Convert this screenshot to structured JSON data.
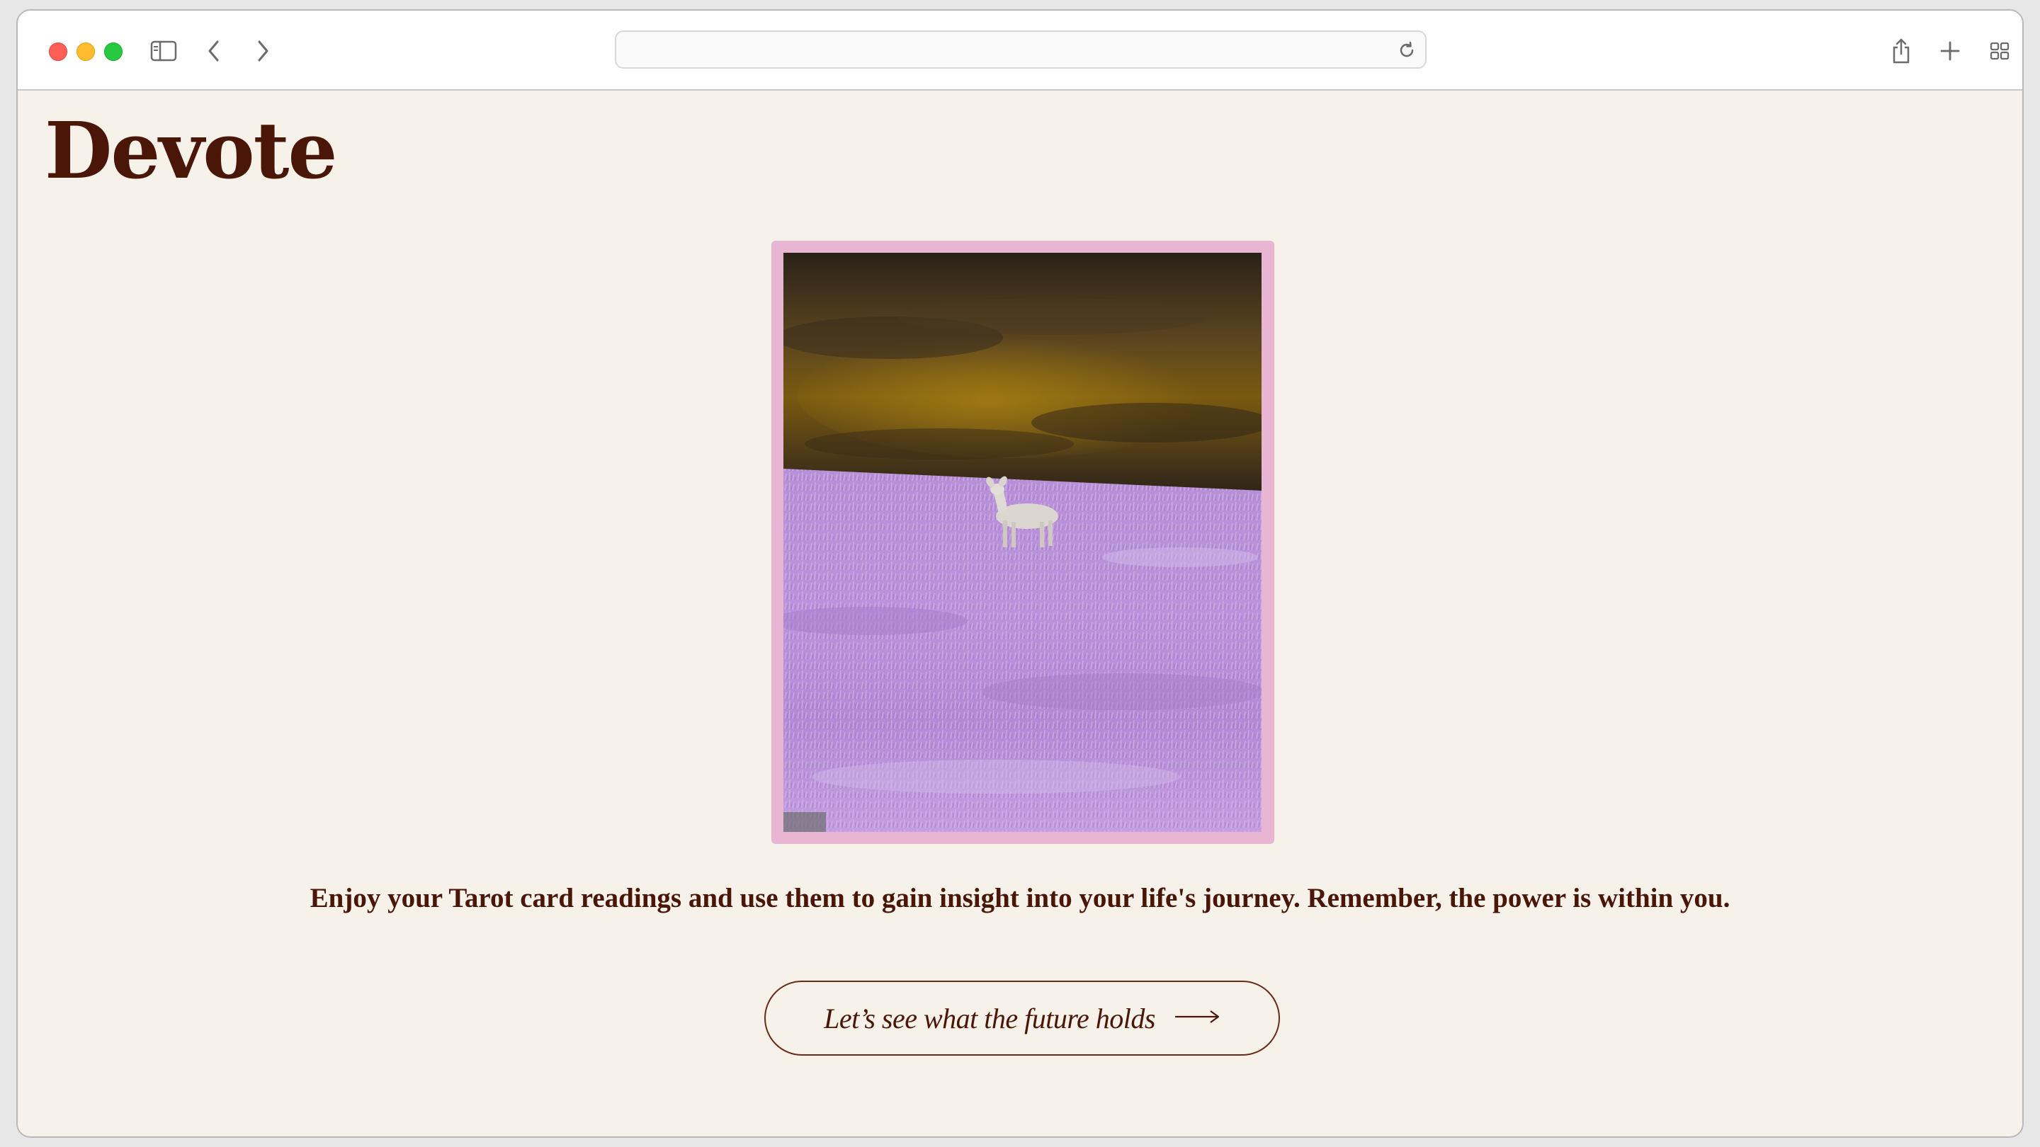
{
  "browser": {
    "address_value": "",
    "address_placeholder": "",
    "icons": {
      "sidebar": "sidebar-icon",
      "back": "chevron-left-icon",
      "forward": "chevron-right-icon",
      "reload": "reload-icon",
      "share": "share-icon",
      "new_tab": "plus-icon",
      "tab_overview": "grid-icon"
    }
  },
  "page": {
    "logo": "Devote",
    "tagline": "Enjoy your Tarot card readings and use them to gain insight into your life's journey. Remember, the power is within you.",
    "cta_label": "Let’s see what the future holds",
    "cta_icon": "arrow-right-icon"
  },
  "colors": {
    "page_background": "#f6f1e9",
    "brand_text": "#4a1608",
    "card_border": "#e8b6d3",
    "field": "#b98ad8"
  }
}
